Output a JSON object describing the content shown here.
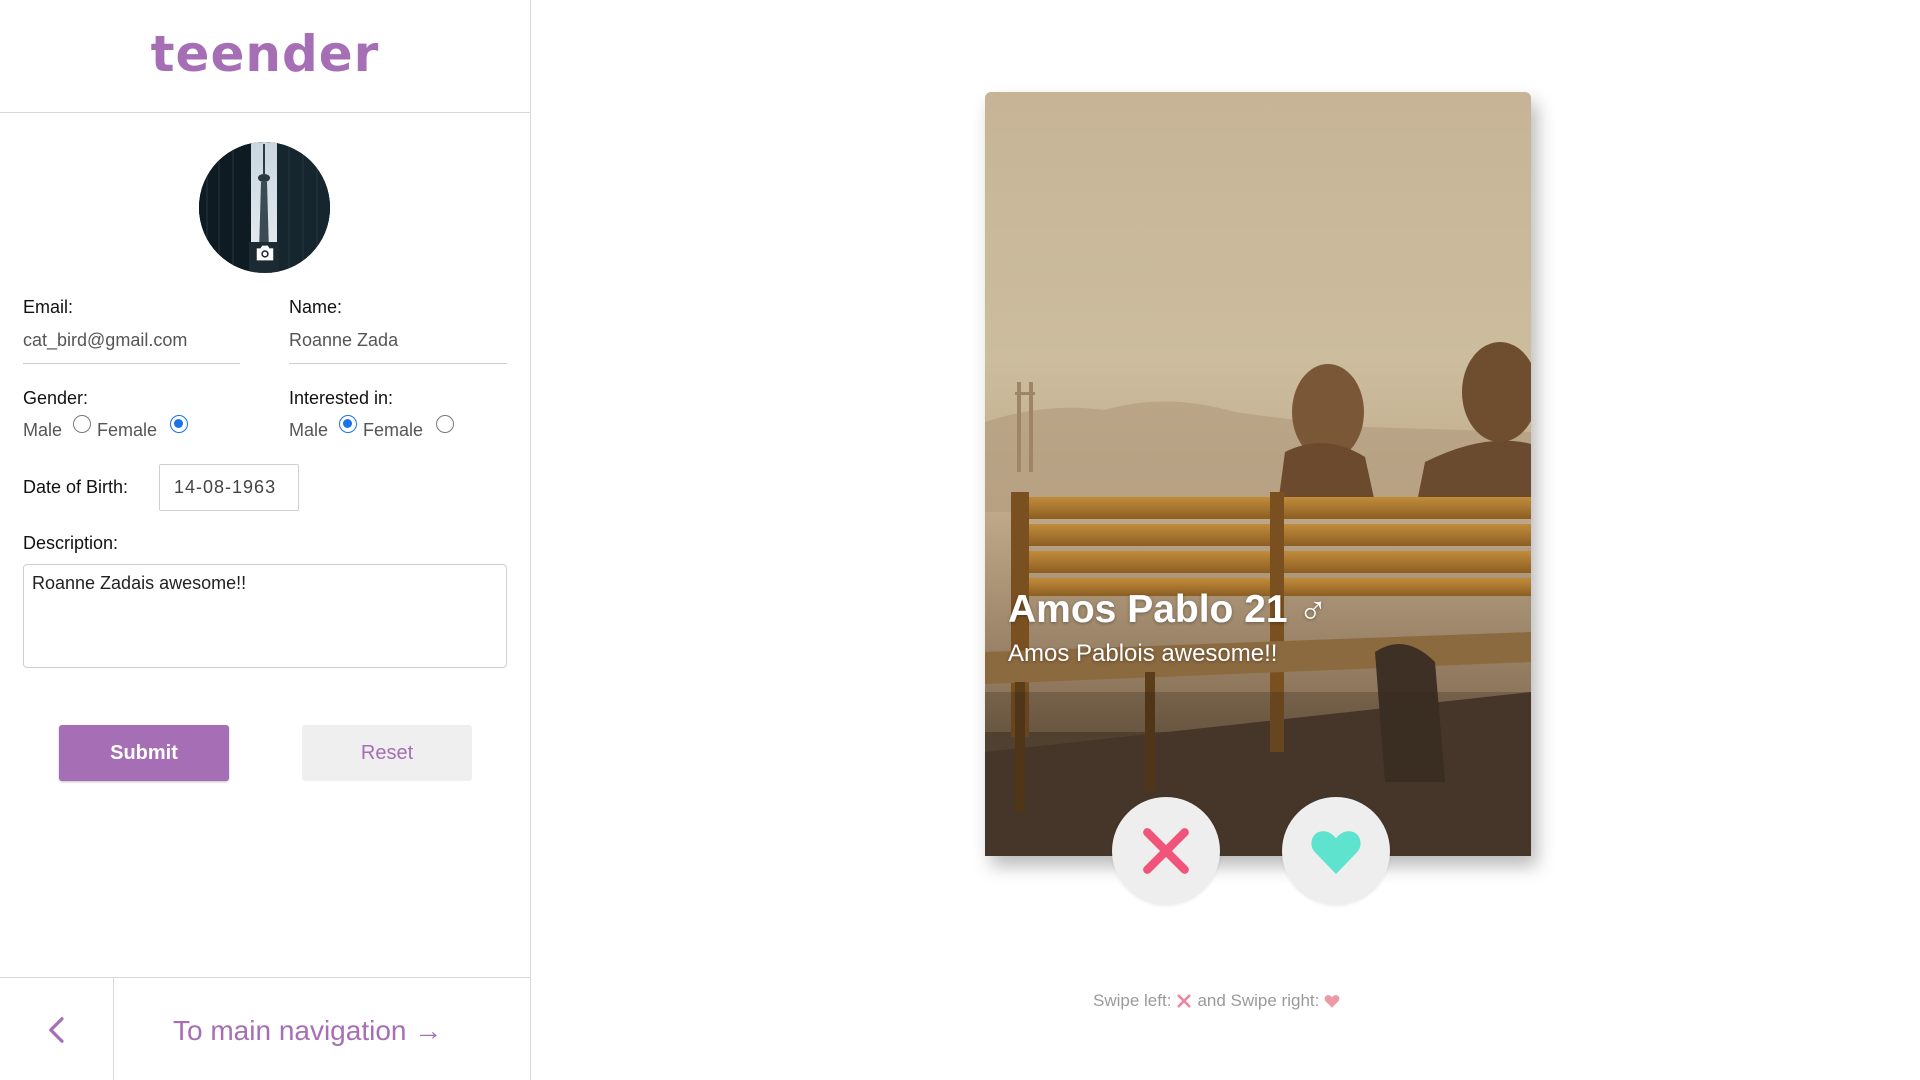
{
  "brand": {
    "name": "teender",
    "color": "#a66fb5"
  },
  "profile": {
    "avatar_icon": "camera-icon",
    "email_label": "Email:",
    "email_value": "cat_bird@gmail.com",
    "name_label": "Name:",
    "name_value": "Roanne Zada",
    "gender_label": "Gender:",
    "gender_options": [
      "Male",
      "Female"
    ],
    "gender_selected": "Female",
    "interested_label": "Interested in:",
    "interested_options": [
      "Male",
      "Female"
    ],
    "interested_selected": "Male",
    "dob_label": "Date of Birth:",
    "dob_value": "14-08-1963",
    "description_label": "Description:",
    "description_value": "Roanne Zadais awesome!!",
    "submit_label": "Submit",
    "reset_label": "Reset"
  },
  "footer": {
    "back_icon": "chevron-left-icon",
    "nav_label": "To main navigation →"
  },
  "card": {
    "title": "Amos Pablo 21 ♂",
    "description": "Amos Pablois awesome!!",
    "dislike_icon": "cross-icon",
    "like_icon": "heart-icon",
    "dislike_color": "#f0547a",
    "like_color": "#5ee3cf"
  },
  "hint": {
    "left_text": "Swipe left:",
    "middle_text": "and Swipe right:",
    "left_icon": "cross-icon",
    "right_icon": "heart-icon"
  }
}
